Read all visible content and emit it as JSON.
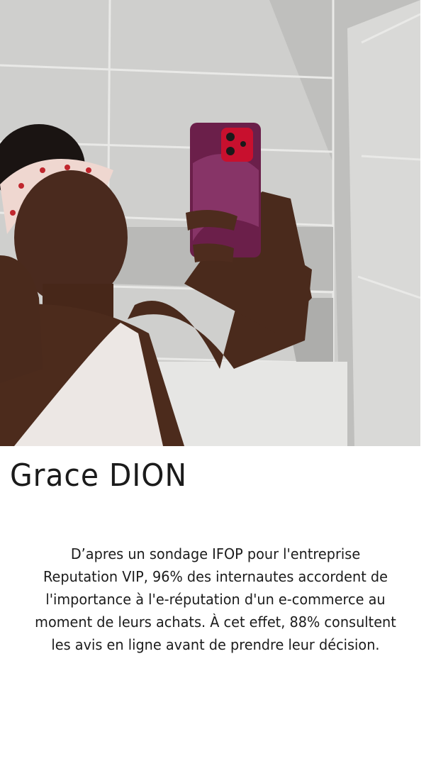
{
  "profile": {
    "name": "Grace DION",
    "description": "D’apres un sondage IFOP pour l'entreprise Reputation VIP, 96% des internautes accordent de l'importance à l'e-réputation d'un e-commerce au moment de leurs achats. À cet effet, 88% consultent les avis en ligne avant de prendre leur décision."
  },
  "colors": {
    "background": "#ffffff",
    "text": "#1b1b1b",
    "phone_case": "#6b1f4a",
    "phone_red": "#c8102e"
  }
}
